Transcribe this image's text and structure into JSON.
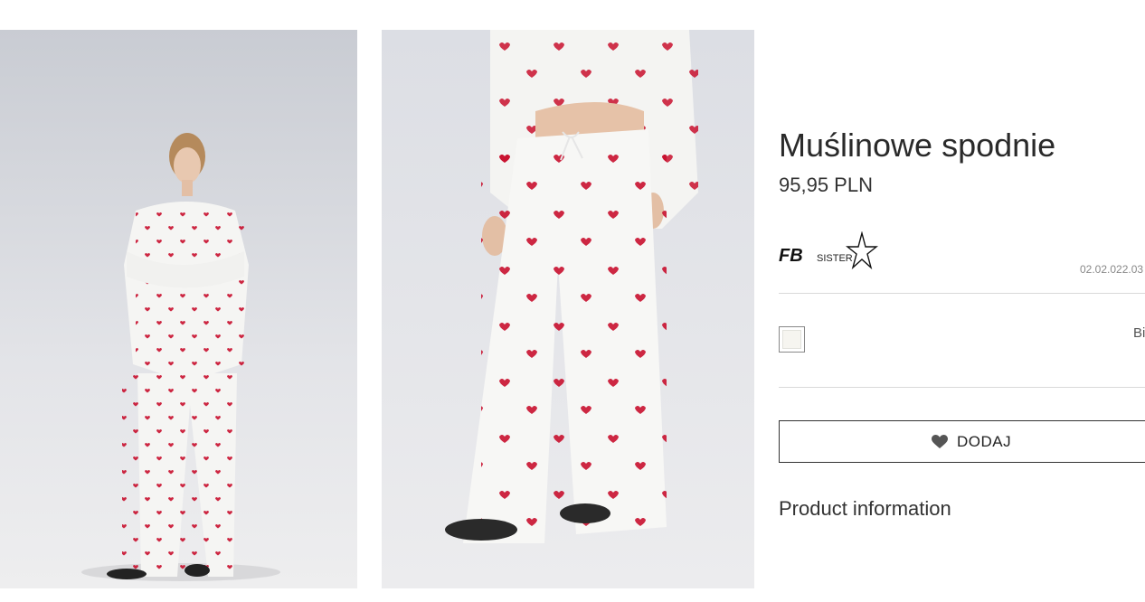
{
  "product": {
    "title": "Muślinowe spodnie",
    "price": "95,95 PLN",
    "sku": "02.02.022.03",
    "color_name": "Bi"
  },
  "brand": {
    "logo_text_main": "FB",
    "logo_text_sub": "SISTER"
  },
  "actions": {
    "add_label": "DODAJ",
    "product_information_label": "Product information"
  },
  "gallery": {
    "photo_1": "full-body-model-icon",
    "photo_2": "pants-closeup-icon"
  },
  "colors": {
    "accent": "#222222",
    "heart": "#c8102e",
    "swatch": "#f6f5f0"
  }
}
